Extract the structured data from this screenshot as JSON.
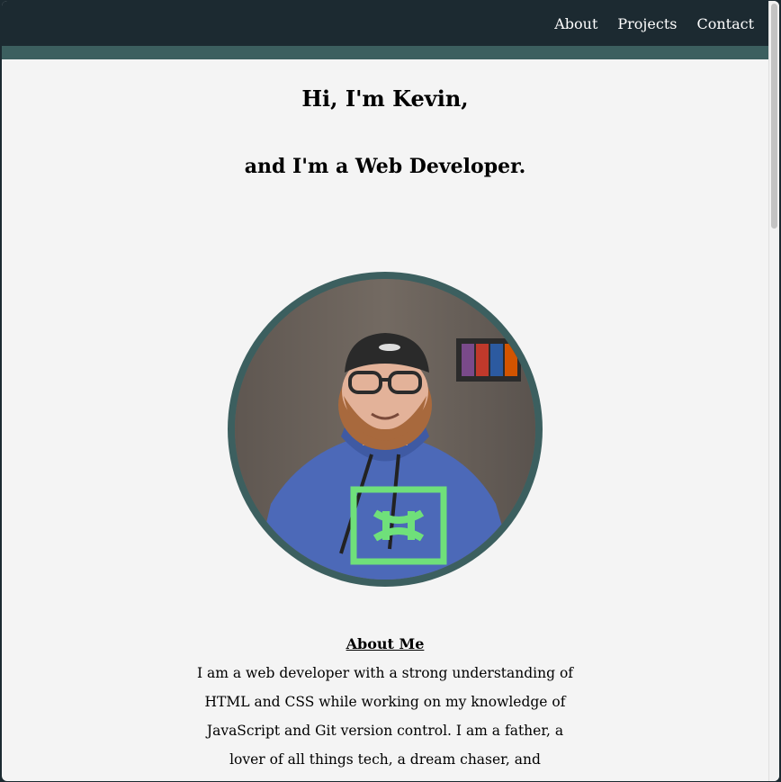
{
  "nav": {
    "links": [
      "About",
      "Projects",
      "Contact"
    ]
  },
  "hero": {
    "greeting": "Hi, I'm Kevin,",
    "tagline": "and I'm a Web Developer."
  },
  "about": {
    "heading": "About Me",
    "body": "I am a web developer with a strong understanding of HTML and CSS while working on my knowledge of JavaScript and Git version control. I am a father, a lover of all things tech, a dream chaser, and occassionally a purveyor of knowledge."
  },
  "colors": {
    "navbar": "#1c2a31",
    "accent": "#3c5f5f",
    "background": "#f4f4f4"
  }
}
